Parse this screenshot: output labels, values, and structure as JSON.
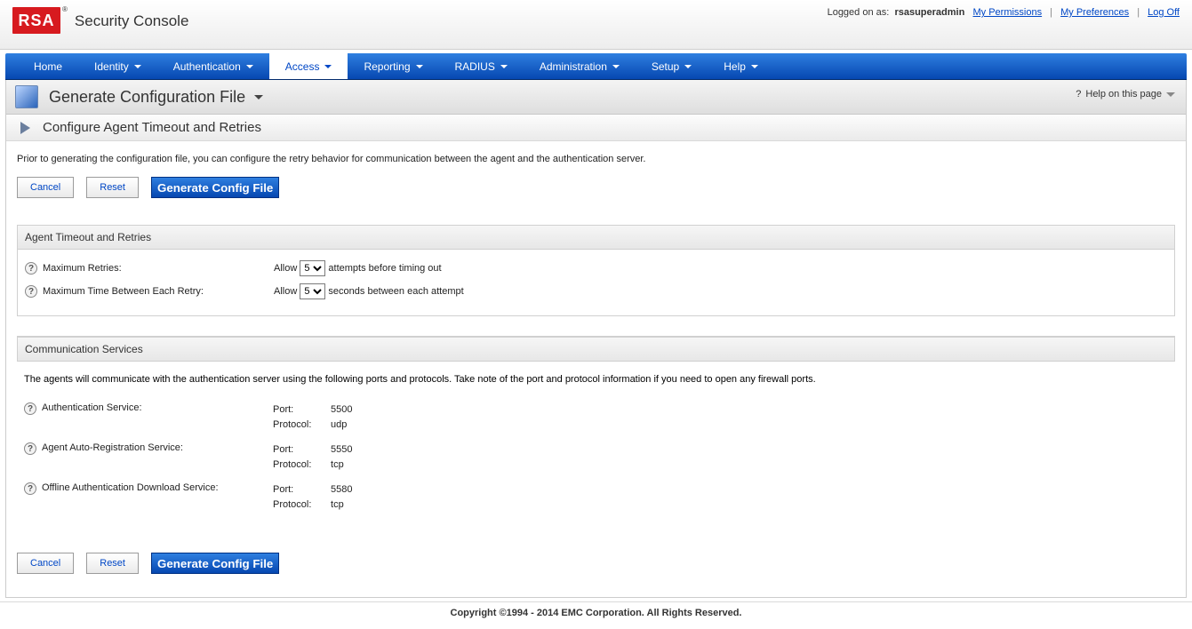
{
  "header": {
    "logo_text": "RSA",
    "product_title": "Security Console",
    "logged_on_prefix": "Logged on as:",
    "username": "rsasuperadmin",
    "link_permissions": "My Permissions",
    "link_preferences": "My Preferences",
    "link_logoff": "Log Off"
  },
  "nav": {
    "items": [
      {
        "label": "Home",
        "caret": false,
        "active": false
      },
      {
        "label": "Identity",
        "caret": true,
        "active": false
      },
      {
        "label": "Authentication",
        "caret": true,
        "active": false
      },
      {
        "label": "Access",
        "caret": true,
        "active": true
      },
      {
        "label": "Reporting",
        "caret": true,
        "active": false
      },
      {
        "label": "RADIUS",
        "caret": true,
        "active": false
      },
      {
        "label": "Administration",
        "caret": true,
        "active": false
      },
      {
        "label": "Setup",
        "caret": true,
        "active": false
      },
      {
        "label": "Help",
        "caret": true,
        "active": false
      }
    ]
  },
  "page": {
    "title": "Generate Configuration File",
    "help_text": "Help on this page",
    "subtitle": "Configure Agent Timeout and Retries",
    "intro": "Prior to generating the configuration file, you can configure the retry behavior for communication between the agent and the authentication server."
  },
  "buttons": {
    "cancel": "Cancel",
    "reset": "Reset",
    "generate": "Generate Config File"
  },
  "timeout_section": {
    "heading": "Agent Timeout and Retries",
    "max_retries_label": "Maximum Retries:",
    "max_retries_prefix": "Allow",
    "max_retries_value": "5",
    "max_retries_suffix": "attempts before timing out",
    "max_time_label": "Maximum Time Between Each Retry:",
    "max_time_prefix": "Allow",
    "max_time_value": "5",
    "max_time_suffix": "seconds between each attempt"
  },
  "comm_section": {
    "heading": "Communication Services",
    "intro": "The agents will communicate with the authentication server using the following ports and protocols. Take note of the port and protocol information if you need to open any firewall ports.",
    "port_label": "Port:",
    "protocol_label": "Protocol:",
    "services": [
      {
        "label": "Authentication Service:",
        "port": "5500",
        "protocol": "udp"
      },
      {
        "label": "Agent Auto-Registration Service:",
        "port": "5550",
        "protocol": "tcp"
      },
      {
        "label": "Offline Authentication Download Service:",
        "port": "5580",
        "protocol": "tcp"
      }
    ]
  },
  "footer": "Copyright ©1994 - 2014 EMC Corporation. All Rights Reserved."
}
